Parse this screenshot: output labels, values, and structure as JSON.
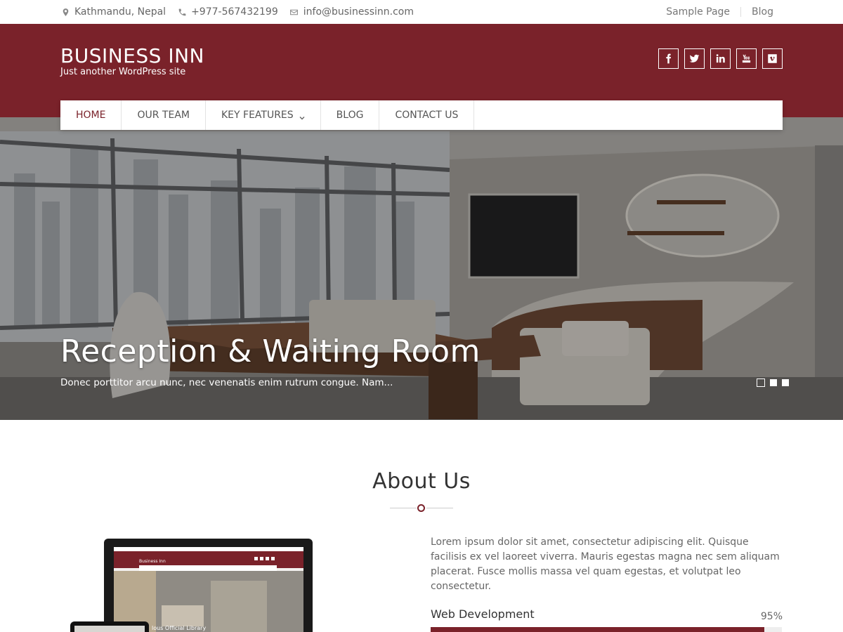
{
  "topbar": {
    "location": "Kathmandu, Nepal",
    "phone": "+977-567432199",
    "email": "info@businessinn.com",
    "links": [
      "Sample Page",
      "Blog"
    ]
  },
  "header": {
    "site_title": "BUSINESS INN",
    "tagline": "Just another WordPress site",
    "social_icons": [
      "facebook-icon",
      "twitter-icon",
      "linkedin-icon",
      "youtube-icon",
      "vimeo-icon"
    ]
  },
  "nav": {
    "items": [
      {
        "label": "HOME",
        "active": true
      },
      {
        "label": "OUR TEAM",
        "active": false
      },
      {
        "label": "KEY FEATURES",
        "active": false,
        "has_dropdown": true
      },
      {
        "label": "BLOG",
        "active": false
      },
      {
        "label": "CONTACT US",
        "active": false
      }
    ]
  },
  "hero": {
    "title": "Reception & Waiting Room",
    "text": "Donec porttitor arcu nunc, nec venenatis enim rutrum congue. Nam...",
    "slide_count": 3,
    "active_slide": 1
  },
  "about": {
    "title": "About Us",
    "text": "Lorem ipsum dolor sit amet, consectetur adipiscing elit. Quisque facilisis ex vel laoreet viverra. Mauris egestas magna nec sem aliquam placerat. Fusce mollis massa vel quam egestas, et volutpat leo consectetur.",
    "skills": [
      {
        "label": "Web Development",
        "percent_text": "95%",
        "percent": 95
      }
    ],
    "mockup": {
      "site_title": "Business Inn",
      "caption": "lous Official Library"
    }
  },
  "colors": {
    "brand": "#7a222a",
    "text_muted": "#666666"
  }
}
